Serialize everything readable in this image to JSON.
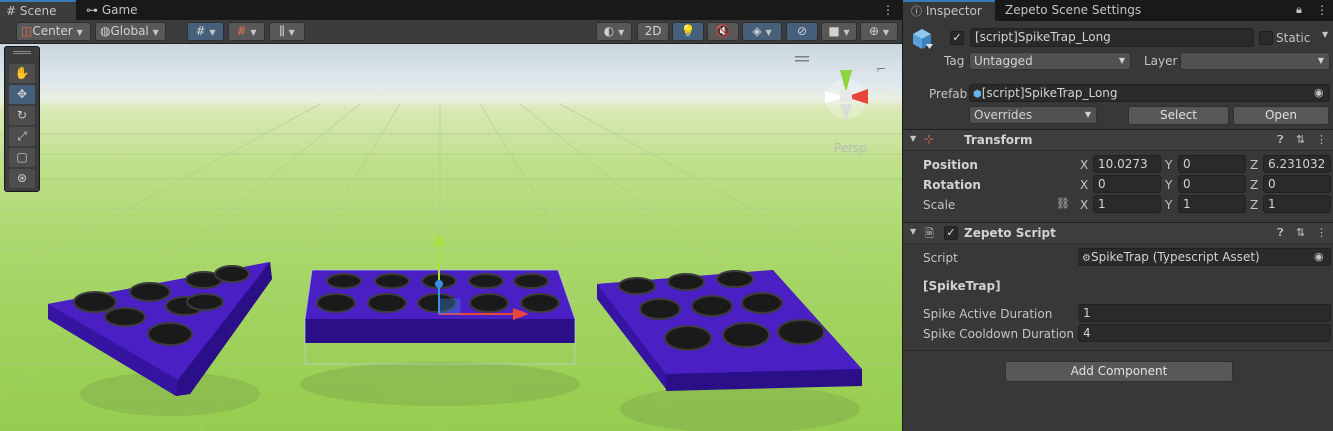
{
  "scene_tabs": [
    {
      "label": "Scene",
      "icon": "grid-icon"
    },
    {
      "label": "Game",
      "icon": "gamepad-icon"
    }
  ],
  "toolbar": {
    "pivot_label": "Center",
    "space_label": "Global",
    "mode_2d_label": "2D"
  },
  "gizmo_label": "Persp",
  "inspector_tabs": [
    {
      "label": "Inspector",
      "icon": "info-icon"
    },
    {
      "label": "Zepeto Scene Settings"
    }
  ],
  "object": {
    "name": "[script]SpikeTrap_Long",
    "active": true,
    "static_label": "Static",
    "tag_label": "Tag",
    "tag_value": "Untagged",
    "layer_label": "Layer",
    "layer_value": "",
    "prefab_label": "Prefab",
    "prefab_value": "[script]SpikeTrap_Long",
    "overrides_label": "Overrides",
    "select_label": "Select",
    "open_label": "Open"
  },
  "transform": {
    "title": "Transform",
    "position": {
      "label": "Position",
      "x": "10.0273",
      "y": "0",
      "z": "6.231032"
    },
    "rotation": {
      "label": "Rotation",
      "x": "0",
      "y": "0",
      "z": "0"
    },
    "scale": {
      "label": "Scale",
      "x": "1",
      "y": "1",
      "z": "1"
    },
    "axis_x": "X",
    "axis_y": "Y",
    "axis_z": "Z"
  },
  "zepeto_script": {
    "title": "Zepeto Script",
    "enabled": true,
    "script_label": "Script",
    "script_value": "SpikeTrap (Typescript Asset)",
    "section_label": "[SpikeTrap]",
    "active_duration_label": "Spike Active Duration",
    "active_duration_value": "1",
    "cooldown_label": "Spike Cooldown Duration",
    "cooldown_value": "4"
  },
  "add_component_label": "Add Component",
  "colors": {
    "accent": "#3a79bb",
    "trap_purple": "#4a1fc4",
    "ground_green": "#9ed15a"
  }
}
